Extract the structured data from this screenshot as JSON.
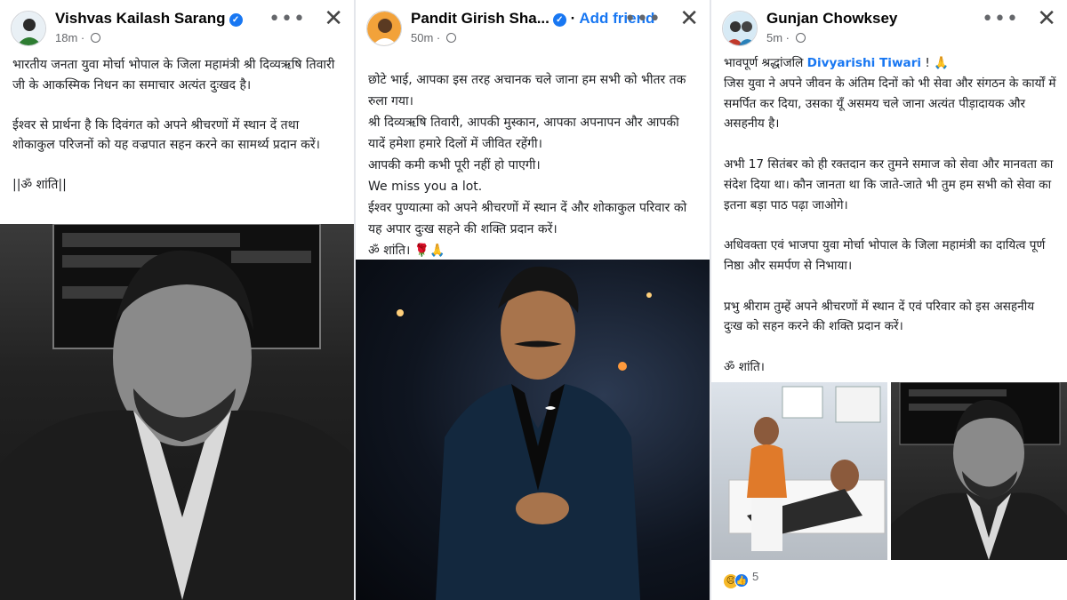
{
  "posts": [
    {
      "author": "Vishvas Kailash Sarang",
      "verified": true,
      "time": "18m",
      "text": "भारतीय जनता युवा मोर्चा भोपाल के जिला महामंत्री श्री दिव्यऋषि तिवारी जी के आकस्मिक निधन का समाचार अत्यंत दुःखद है।\n\nईश्वर से प्रार्थना है कि दिवंगत को अपने श्रीचरणों में स्थान दें तथा शोकाकुल परिजनों को यह वज्रपात सहन करने का सामर्थ्य प्रदान करें।\n\n||ॐ शांति||",
      "photo_icon": "portrait-photo-bw"
    },
    {
      "author": "Pandit Girish Sha...",
      "verified": true,
      "add_friend": "Add friend",
      "time": "50m",
      "text": "छोटे भाई, आपका इस तरह अचानक चले जाना हम सभी को भीतर तक रुला गया।\nश्री दिव्यऋषि तिवारी, आपकी मुस्कान, आपका अपनापन और आपकी यादें हमेशा हमारे दिलों में जीवित रहेंगी।\nआपकी कमी कभी पूरी नहीं हो पाएगी।\nWe miss you a lot.\nईश्वर पुण्यात्मा को अपने श्रीचरणों में स्थान दें और शोकाकुल परिवार को यह अपार दुःख सहने की शक्ति प्रदान करें।\nॐ शांति। 🌹🙏",
      "photo_icon": "portrait-photo-suit"
    },
    {
      "author": "Gunjan Chowksey",
      "verified": false,
      "time": "5m",
      "text_prefix": "भावपूर्ण श्रद्धांजलि ",
      "tagged_name": "Divyarishi Tiwari",
      "text_suffix": " ! 🙏\nजिस युवा ने अपने जीवन के अंतिम दिनों को भी सेवा और संगठन के कार्यों में समर्पित कर दिया, उसका यूँ असमय चले जाना अत्यंत पीड़ादायक और असहनीय है।\n\nअभी 17 सितंबर को ही रक्तदान कर तुमने समाज को सेवा और मानवता का संदेश दिया था। कौन जानता था कि जाते-जाते भी तुम हम सभी को सेवा का इतना बड़ा पाठ पढ़ा जाओगे।\n\nअधिवक्ता एवं भाजपा युवा मोर्चा भोपाल के जिला महामंत्री का दायित्व पूर्ण निष्ठा और समर्पण से निभाया।\n\nप्रभु श्रीराम तुम्हें अपने श्रीचरणों में स्थान दें एवं परिवार को इस असहनीय दुःख को सहन करने की शक्ति प्रदान करें।\n\nॐ शांति।",
      "reaction_count": "5",
      "photo_icons": [
        "hospital-photo",
        "portrait-photo"
      ]
    }
  ],
  "icons": {
    "more": "more-options-icon",
    "close": "close-icon",
    "audience": "globe-icon",
    "verified": "verified-badge-icon"
  },
  "colors": {
    "link": "#1877f2",
    "meta": "#65676b"
  }
}
